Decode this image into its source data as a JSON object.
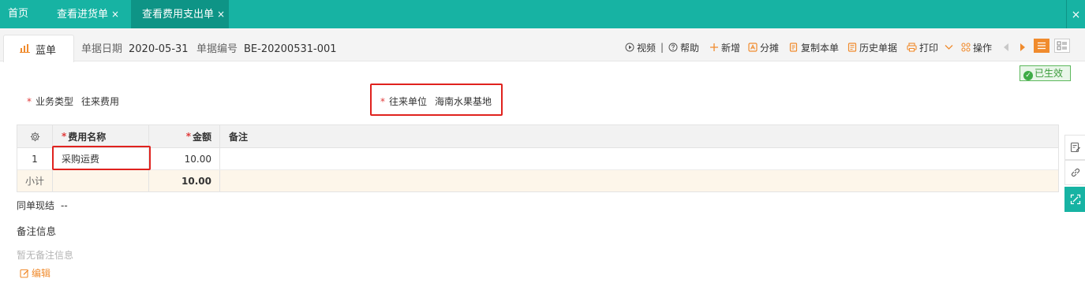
{
  "tabs": [
    {
      "label": "首页",
      "closable": false
    },
    {
      "label": "查看进货单",
      "closable": true
    },
    {
      "label": "查看费用支出单",
      "closable": true,
      "active": true
    }
  ],
  "close_glyph": "×",
  "window_close_glyph": "×",
  "doc_tab": {
    "label": "蓝单",
    "icon": "chart-icon"
  },
  "meta": {
    "date_label": "单据日期",
    "date_value": "2020-05-31",
    "number_label": "单据编号",
    "number_value": "BE-20200531-001"
  },
  "toolbar": {
    "video": "视频",
    "divider": "|",
    "help": "帮助",
    "new": "新增",
    "split": "分摊",
    "copy": "复制本单",
    "history": "历史单据",
    "print": "打印",
    "operate": "操作"
  },
  "status": {
    "label": "已生效",
    "check": "✓"
  },
  "form": {
    "required_mark": "*",
    "biz_type_label": "业务类型",
    "biz_type_value": "往来费用",
    "partner_label": "往来单位",
    "partner_value": "海南水果基地"
  },
  "table": {
    "headers": [
      "",
      "费用名称",
      "金额",
      "备注"
    ],
    "rows": [
      {
        "index": "1",
        "name": "采购运费",
        "amount": "10.00",
        "note": ""
      }
    ],
    "subtotal_label": "小计",
    "subtotal_amount": "10.00"
  },
  "settlement": {
    "label": "同单现结",
    "value": "--"
  },
  "notes": {
    "title": "备注信息",
    "empty": "暂无备注信息",
    "edit": "编辑"
  },
  "colors": {
    "brand": "#17b3a3",
    "accent": "#f08b2d",
    "required": "#e03b3b",
    "highlight": "#e0221e",
    "success": "#3fab47"
  }
}
